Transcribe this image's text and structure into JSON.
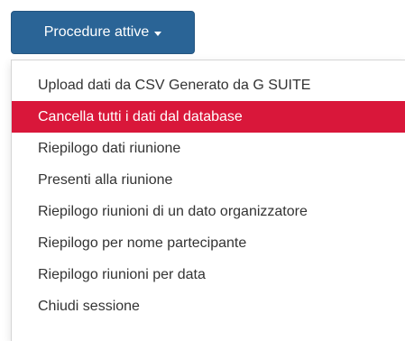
{
  "colors": {
    "button_bg": "#2a6496",
    "accent": "#d9173a"
  },
  "dropdown": {
    "label": "Procedure attive",
    "caret_icon": "caret-down-icon"
  },
  "menu": {
    "active_index": 1,
    "items": [
      {
        "label": "Upload dati da CSV Generato da G SUITE"
      },
      {
        "label": "Cancella tutti i dati dal database"
      },
      {
        "label": "Riepilogo dati riunione"
      },
      {
        "label": "Presenti alla riunione"
      },
      {
        "label": "Riepilogo riunioni di un dato organizzatore"
      },
      {
        "label": "Riepilogo per nome partecipante"
      },
      {
        "label": "Riepilogo riunioni per data"
      },
      {
        "label": "Chiudi sessione"
      }
    ]
  }
}
